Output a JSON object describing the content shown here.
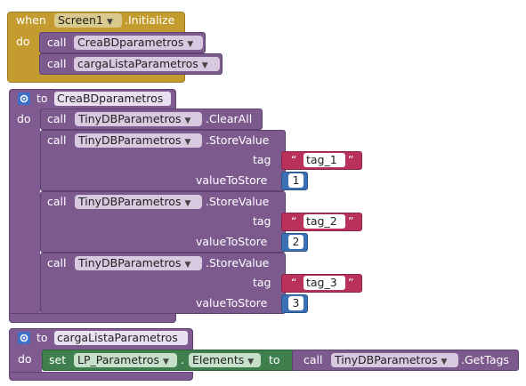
{
  "event_block": {
    "when_label": "when",
    "component": "Screen1",
    "event": ".Initialize",
    "do_label": "do",
    "calls": [
      {
        "call_label": "call",
        "procedure": "CreaBDparametros"
      },
      {
        "call_label": "call",
        "procedure": "cargaListaParametros"
      }
    ]
  },
  "proc1": {
    "to_label": "to",
    "name": "CreaBDparametros",
    "do_label": "do",
    "clearall": {
      "call_label": "call",
      "component": "TinyDBParametros",
      "method": ".ClearAll"
    },
    "stores": [
      {
        "call_label": "call",
        "component": "TinyDBParametros",
        "method": ".StoreValue",
        "tag_label": "tag",
        "tag_value": "tag_1",
        "value_label": "valueToStore",
        "value": "1"
      },
      {
        "call_label": "call",
        "component": "TinyDBParametros",
        "method": ".StoreValue",
        "tag_label": "tag",
        "tag_value": "tag_2",
        "value_label": "valueToStore",
        "value": "2"
      },
      {
        "call_label": "call",
        "component": "TinyDBParametros",
        "method": ".StoreValue",
        "tag_label": "tag",
        "tag_value": "tag_3",
        "value_label": "valueToStore",
        "value": "3"
      }
    ],
    "open_quote": "“",
    "close_quote": "”"
  },
  "proc2": {
    "to_label": "to",
    "name": "cargaListaParametros",
    "do_label": "do",
    "set_label": "set",
    "set_component": "LP_Parametros",
    "dot": ".",
    "property": "Elements",
    "to_label2": "to",
    "call_label": "call",
    "getter_component": "TinyDBParametros",
    "getter_method": ".GetTags"
  },
  "icons": {
    "gear": "gear-icon",
    "dropdown": "dropdown-arrow-icon"
  },
  "colors": {
    "event": "#c39b2f",
    "procedure": "#7c5a8e",
    "setter": "#3f7f4e",
    "text": "#b8325c",
    "number": "#3c70b5"
  }
}
